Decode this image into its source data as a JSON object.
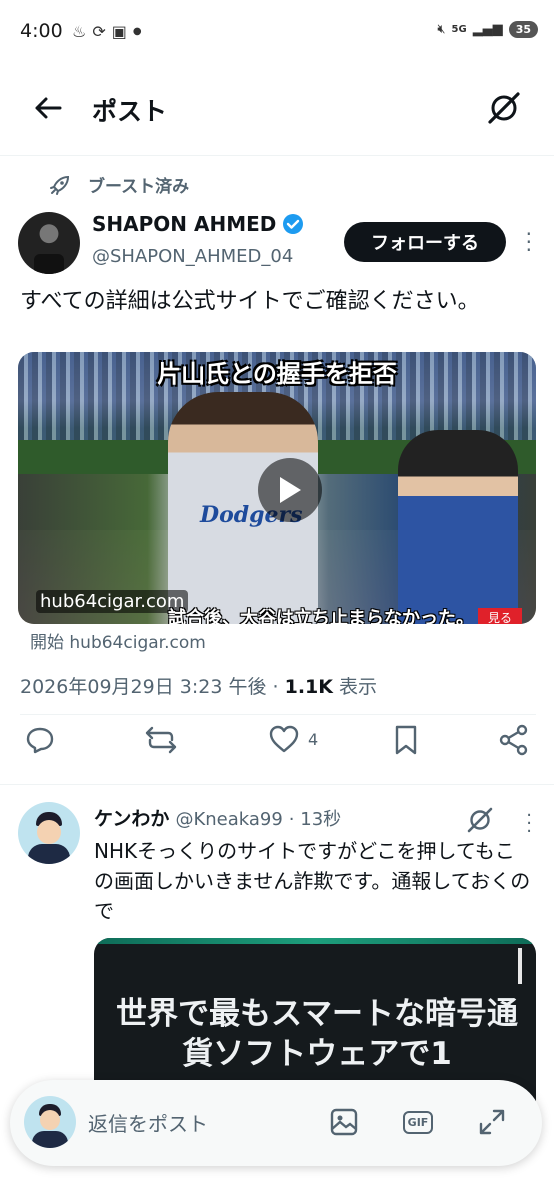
{
  "status_bar": {
    "time": "4:00",
    "network": "5G",
    "battery": "35"
  },
  "header": {
    "title": "ポスト"
  },
  "post": {
    "boost_label": "ブースト済み",
    "author_name": "SHAPON AHMED",
    "author_handle": "@SHAPON_AHMED_04",
    "follow_label": "フォローする",
    "text": "すべての詳細は公式サイトでご確認ください。",
    "media": {
      "headline": "片山氏との握手を拒否",
      "domain": "hub64cigar.com",
      "subtitle": "試合後、大谷は立ち止まらなかった。",
      "watch_label": "見る",
      "jersey_text": "Dodgers"
    },
    "source_line": "開始 hub64cigar.com",
    "timestamp": "2026年09月29日 3:23 午後",
    "view_count": "1.1K",
    "view_label": "表示",
    "like_count": "4"
  },
  "reply": {
    "name": "ケンわか",
    "handle": "@Kneaka99",
    "time": "· 13秒",
    "text": "NHKそっくりのサイトですがどこを押してもこの画面しかいきません詐欺です。通報しておくので",
    "image_text": "世界で最もスマートな暗号通貨ソフトウェアで1"
  },
  "compose": {
    "placeholder": "返信をポスト",
    "gif_label": "GIF"
  },
  "colors": {
    "primary_text": "#0f1419",
    "secondary_text": "#536471",
    "verified_blue": "#1d9bf0",
    "watch_red": "#e0212a"
  },
  "icons": [
    "back-arrow-icon",
    "grok-icon",
    "rocket-icon",
    "verified-icon",
    "more-icon",
    "reply-icon",
    "repost-icon",
    "like-icon",
    "bookmark-icon",
    "share-icon",
    "image-icon",
    "gif-icon",
    "expand-icon"
  ]
}
